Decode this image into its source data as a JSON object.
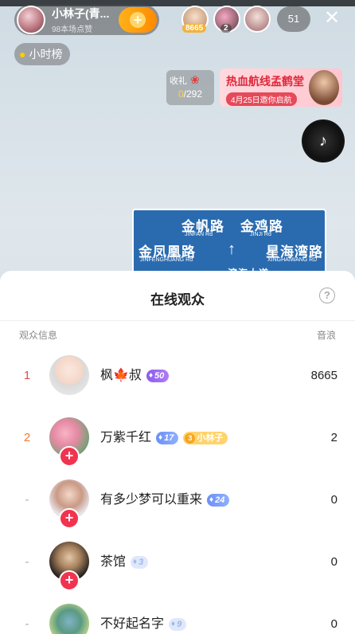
{
  "host": {
    "name": "小林子(青...",
    "likes": "98本场点赞",
    "follow_symbol": "+"
  },
  "top_viewers": [
    {
      "count": "8665"
    },
    {
      "count": "2"
    }
  ],
  "viewer_count": "51",
  "close_symbol": "✕",
  "hour_rank_label": "小时榜",
  "gift": {
    "label": "收礼",
    "current": "0",
    "total": "/292"
  },
  "promo": {
    "title": "热血航线孟鹤堂",
    "subtitle": "4月25日邀你启航"
  },
  "road_sign": {
    "line1_a": "金帆路",
    "line1_a_py": "JINFAN Rd",
    "line1_b": "金鸡路",
    "line1_b_py": "JINJI Rd",
    "line2_a": "金凤凰路",
    "line2_a_py": "JINFENGHUANG Rd",
    "line2_b": "星海湾路",
    "line2_b_py": "XINGHAIWANG RD",
    "line3": "滨海大道",
    "arrow": "↑",
    "left_arrow": "←"
  },
  "sheet": {
    "title": "在线观众",
    "help_symbol": "?",
    "col_left": "观众信息",
    "col_right": "音浪",
    "rows": [
      {
        "rank": "1",
        "name": "枫🍁叔",
        "badge1": "50",
        "badge1_icon": "♦",
        "score": "8665"
      },
      {
        "rank": "2",
        "name": "万紫千红",
        "badge1": "17",
        "badge1_icon": "♦",
        "fan_level": "3",
        "fan_name": "小林子",
        "score": "2"
      },
      {
        "rank": "-",
        "name": "有多少梦可以重来",
        "badge1": "24",
        "badge1_icon": "♦",
        "score": "0"
      },
      {
        "rank": "-",
        "name": "茶馆",
        "badge1": "3",
        "badge1_icon": "♦",
        "score": "0"
      },
      {
        "rank": "-",
        "name": "不好起名字",
        "badge1": "9",
        "badge1_icon": "♦",
        "score": "0"
      }
    ],
    "follow_symbol": "+"
  }
}
